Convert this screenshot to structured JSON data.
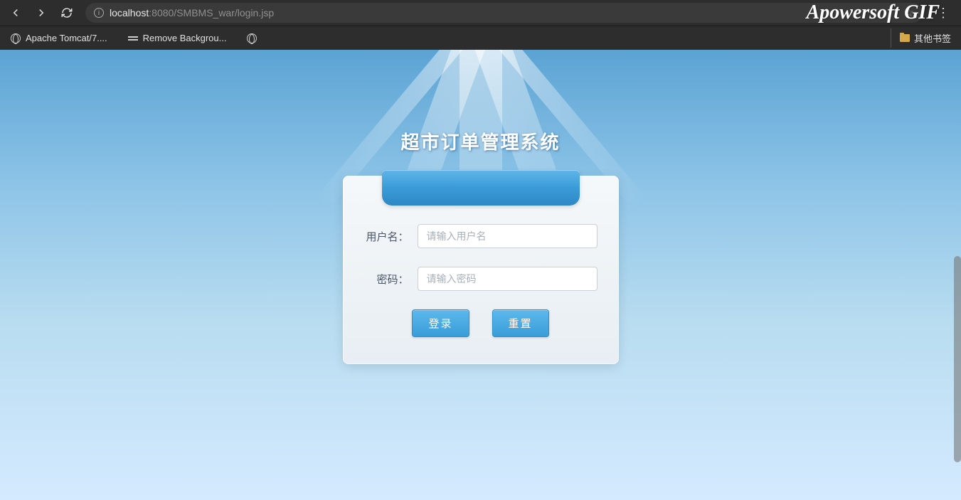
{
  "browser": {
    "url_host": "localhost",
    "url_port_path": ":8080/SMBMS_war/login.jsp"
  },
  "bookmarks": {
    "items": [
      {
        "label": "Apache Tomcat/7...."
      },
      {
        "label": "Remove Backgrou..."
      }
    ],
    "other_label": "其他书签"
  },
  "watermark": "Apowersoft GIF",
  "page": {
    "title": "超市订单管理系统",
    "form": {
      "username_label": "用户名：",
      "username_placeholder": "请输入用户名",
      "password_label": "密码：",
      "password_placeholder": "请输入密码",
      "login_button": "登录",
      "reset_button": "重置"
    }
  }
}
